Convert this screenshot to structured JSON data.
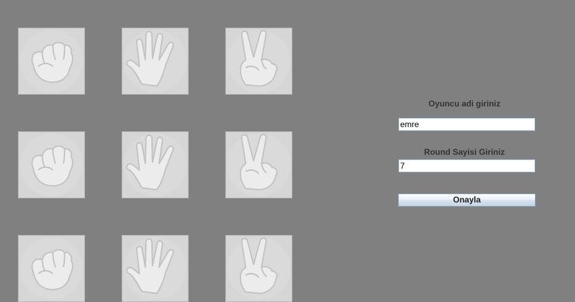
{
  "form": {
    "player_label": "Oyuncu adi giriniz",
    "player_value": "emre",
    "round_label": "Round Sayisi Giriniz",
    "round_value": "7",
    "confirm_label": "Onayla"
  },
  "tiles": [
    {
      "gesture": "rock"
    },
    {
      "gesture": "paper"
    },
    {
      "gesture": "scissors"
    },
    {
      "gesture": "rock"
    },
    {
      "gesture": "paper"
    },
    {
      "gesture": "scissors"
    },
    {
      "gesture": "rock"
    },
    {
      "gesture": "paper"
    },
    {
      "gesture": "scissors"
    }
  ],
  "colors": {
    "background": "#808080",
    "tile": "#d6d6d6",
    "label_text": "#333333"
  }
}
